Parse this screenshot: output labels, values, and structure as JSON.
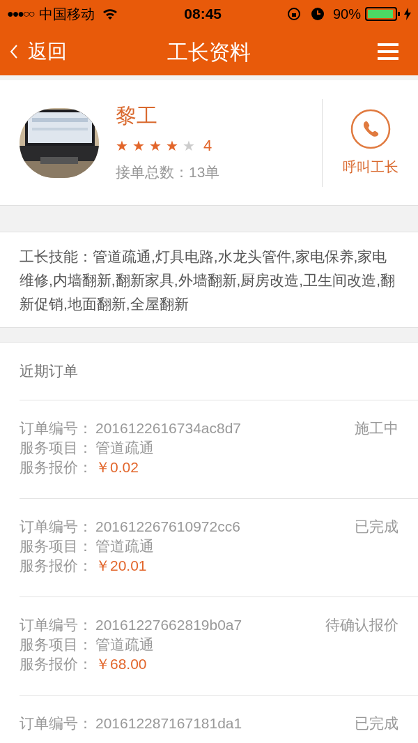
{
  "status_bar": {
    "signal": "●●●○○",
    "carrier": "中国移动",
    "time": "08:45",
    "battery": "90%"
  },
  "nav": {
    "back": "返回",
    "title": "工长资料"
  },
  "profile": {
    "name": "黎工",
    "stars": 4,
    "rating": "4",
    "orders_label": "接单总数：",
    "orders_count": "13单",
    "call": "呼叫工长"
  },
  "skills": {
    "label": "工长技能：",
    "text": "管道疏通,灯具电路,水龙头管件,家电保养,家电维修,内墙翻新,翻新家具,外墙翻新,厨房改造,卫生间改造,翻新促销,地面翻新,全屋翻新"
  },
  "recent_orders": {
    "title": "近期订单",
    "orders": [
      {
        "number_label": "订单编号：",
        "number": "2016122616734ac8d7",
        "status": "施工中",
        "service_label": "服务项目：",
        "service": "管道疏通",
        "price_label": "服务报价：",
        "price": "￥0.02"
      },
      {
        "number_label": "订单编号：",
        "number": "201612267610972cc6",
        "status": "已完成",
        "service_label": "服务项目：",
        "service": "管道疏通",
        "price_label": "服务报价：",
        "price": "￥20.01"
      },
      {
        "number_label": "订单编号：",
        "number": "20161227662819b0a7",
        "status": "待确认报价",
        "service_label": "服务项目：",
        "service": "管道疏通",
        "price_label": "服务报价：",
        "price": "￥68.00"
      },
      {
        "number_label": "订单编号：",
        "number": "201612287167181da1",
        "status": "已完成"
      }
    ]
  }
}
